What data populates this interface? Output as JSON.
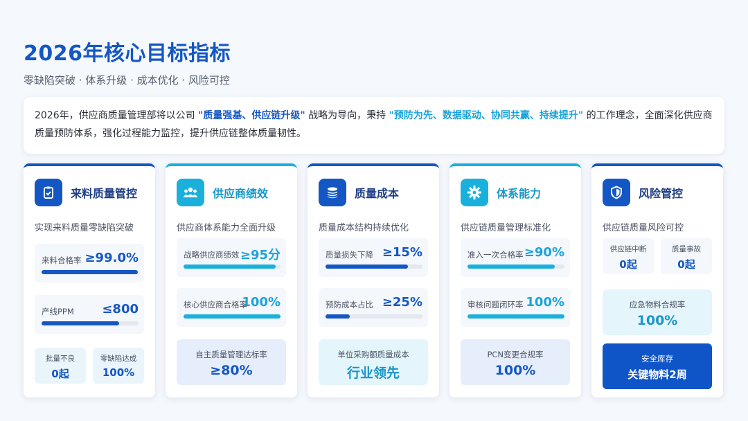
{
  "title": "2026年核心目标指标",
  "subtitle": "零缺陷突破 · 体系升级 · 成本优化 · 风险可控",
  "intro": {
    "part1": "2026年，供应商质量管理部将以公司 ",
    "highlight1": "\"质量强基、供应链升级\"",
    "part2": " 战略为导向，秉持 ",
    "highlight2": "\"预防为先、数据驱动、协同共赢、持续提升\"",
    "part3": " 的工作理念，全面深化供应商质量预防体系，强化过程能力监控，提升供应链整体质量韧性。"
  },
  "colors": {
    "primary": "#1457c4",
    "accent": "#1ab0dc",
    "solid_box": "#0f55c8"
  },
  "cards": [
    {
      "icon": "clipboard-check-icon",
      "title": "来料质量管控",
      "desc": "实现来料质量零缺陷突破",
      "metrics": [
        {
          "label": "来料合格率",
          "value": "≥99.0%",
          "progress": 0.99
        },
        {
          "label": "产线PPM",
          "value": "≤800",
          "progress": 0.8
        }
      ],
      "minis": [
        {
          "label": "批量不良",
          "value": "0起"
        },
        {
          "label": "零缺陷达成",
          "value": "100%"
        }
      ]
    },
    {
      "icon": "users-icon",
      "title": "供应商绩效",
      "desc": "供应商体系能力全面升级",
      "metrics": [
        {
          "label": "战略供应商绩效",
          "value": "≥95分",
          "progress": 0.95
        },
        {
          "label": "核心供应商合格率",
          "value": "100%",
          "progress": 1.0
        }
      ],
      "box": {
        "label": "自主质量管理达标率",
        "value": "≥80%"
      }
    },
    {
      "icon": "coins-icon",
      "title": "质量成本",
      "desc": "质量成本结构持续优化",
      "metrics": [
        {
          "label": "质量损失下降",
          "value": "≥15%",
          "progress": 0.85
        },
        {
          "label": "预防成本占比",
          "value": "≥25%",
          "progress": 0.25
        }
      ],
      "box": {
        "label": "单位采购额质量成本",
        "value": "行业领先"
      }
    },
    {
      "icon": "gear-icon",
      "title": "体系能力",
      "desc": "供应链质量管理标准化",
      "metrics": [
        {
          "label": "准入一次合格率",
          "value": "≥90%",
          "progress": 0.9
        },
        {
          "label": "审核问题闭环率",
          "value": "100%",
          "progress": 1.0
        }
      ],
      "box": {
        "label": "PCN变更合规率",
        "value": "100%"
      }
    },
    {
      "icon": "shield-icon",
      "title": "风险管控",
      "desc": "供应链质量风险可控",
      "minis": [
        {
          "label": "供应链中断",
          "value": "0起"
        },
        {
          "label": "质量事故",
          "value": "0起"
        }
      ],
      "box": {
        "label": "应急物料合规率",
        "value": "100%"
      },
      "solid": {
        "label": "安全库存",
        "value": "关键物料2周"
      }
    }
  ]
}
